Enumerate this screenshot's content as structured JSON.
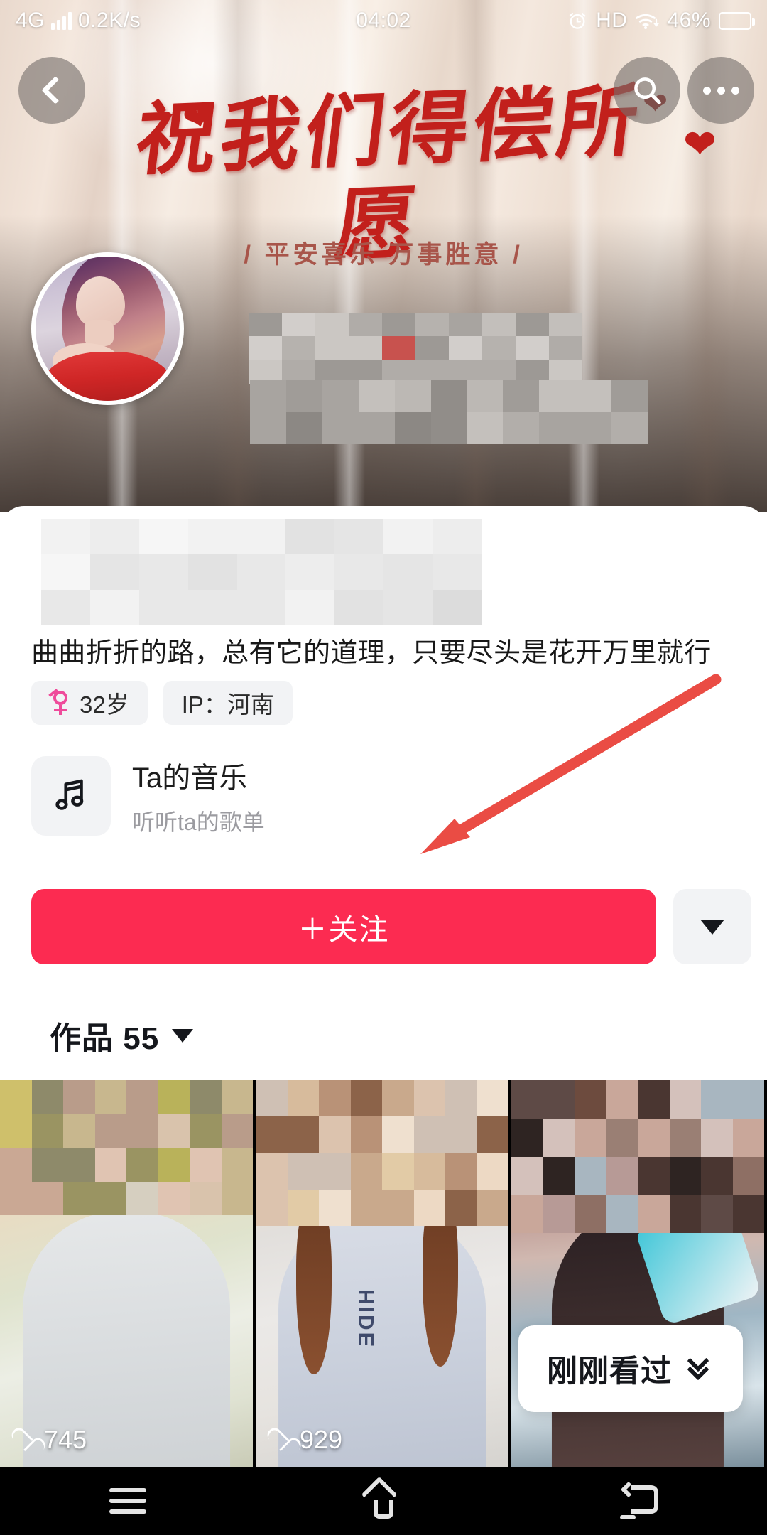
{
  "status_bar": {
    "network_type": "4G",
    "data_rate": "0.2K/s",
    "time": "04:02",
    "hd_label": "HD",
    "battery_percent": "46%",
    "alarm_icon": "alarm-clock-icon",
    "wifi_icon": "wifi-icon",
    "signal_icon": "signal-bars-icon",
    "battery_icon": "battery-icon"
  },
  "header": {
    "back_icon": "chevron-left-icon",
    "search_icon": "search-icon",
    "more_icon": "more-dots-icon",
    "banner_calligraphy": "祝我们得偿所愿",
    "banner_subtitle": "/ 平安喜乐 万事胜意 /",
    "heart_decor": "heart-icon"
  },
  "profile": {
    "avatar": "user-avatar",
    "username_redacted": "mosaic-censored-username",
    "bio": "曲曲折折的路，总有它的道理，只要尽头是花开万里就行",
    "tags": [
      {
        "name": "age-tag",
        "icon": "female-gender-icon",
        "label": "32岁"
      },
      {
        "name": "ip-location-tag",
        "icon": "",
        "label": "IP：河南"
      }
    ]
  },
  "music": {
    "icon": "music-note-icon",
    "title": "Ta的音乐",
    "subtitle": "听听ta的歌单"
  },
  "actions": {
    "follow_label": "＋关注",
    "follow_color": "#fc2b51",
    "more_icon": "caret-down-icon"
  },
  "works": {
    "tab_label": "作品 55",
    "caret_icon": "caret-down-icon",
    "count": "55",
    "items": [
      {
        "name": "video-thumb-1",
        "likes": "745",
        "like_icon": "heart-outline-icon",
        "shirt_text": ""
      },
      {
        "name": "video-thumb-2",
        "likes": "929",
        "like_icon": "heart-outline-icon",
        "shirt_text": "HIDE"
      },
      {
        "name": "video-thumb-3",
        "likes": "",
        "like_icon": "heart-outline-icon",
        "shirt_text": ""
      }
    ]
  },
  "just_viewed": {
    "label": "刚刚看过",
    "icon": "double-chevron-down-icon"
  },
  "annotation": {
    "arrow_color": "#ea4c44",
    "arrow_name": "red-pointer-arrow"
  },
  "navbar": {
    "menu_icon": "menu-icon",
    "home_icon": "home-icon",
    "back_icon": "back-icon"
  }
}
